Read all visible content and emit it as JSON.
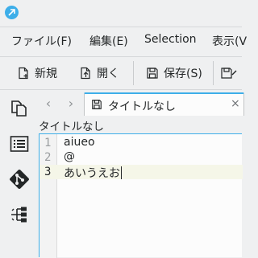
{
  "menubar": {
    "items": [
      "ファイル(F)",
      "編集(E)",
      "Selection",
      "表示(V"
    ]
  },
  "toolbar": {
    "new_label": "新規",
    "open_label": "開く",
    "save_label": "保存(S)"
  },
  "tabs": [
    {
      "label": "タイトルなし",
      "close": "×"
    }
  ],
  "nav": {
    "back": "‹",
    "forward": "›"
  },
  "document": {
    "filename": "タイトルなし",
    "current_line": 3,
    "lines": [
      {
        "number": "1",
        "text": "aiueo"
      },
      {
        "number": "2",
        "text": "@"
      },
      {
        "number": "3",
        "text": "あいうえお"
      }
    ]
  },
  "colors": {
    "accent": "#3daee9",
    "background": "#eff0f1",
    "editor_bg": "#fcfcfc",
    "git_icon": "#232627"
  }
}
